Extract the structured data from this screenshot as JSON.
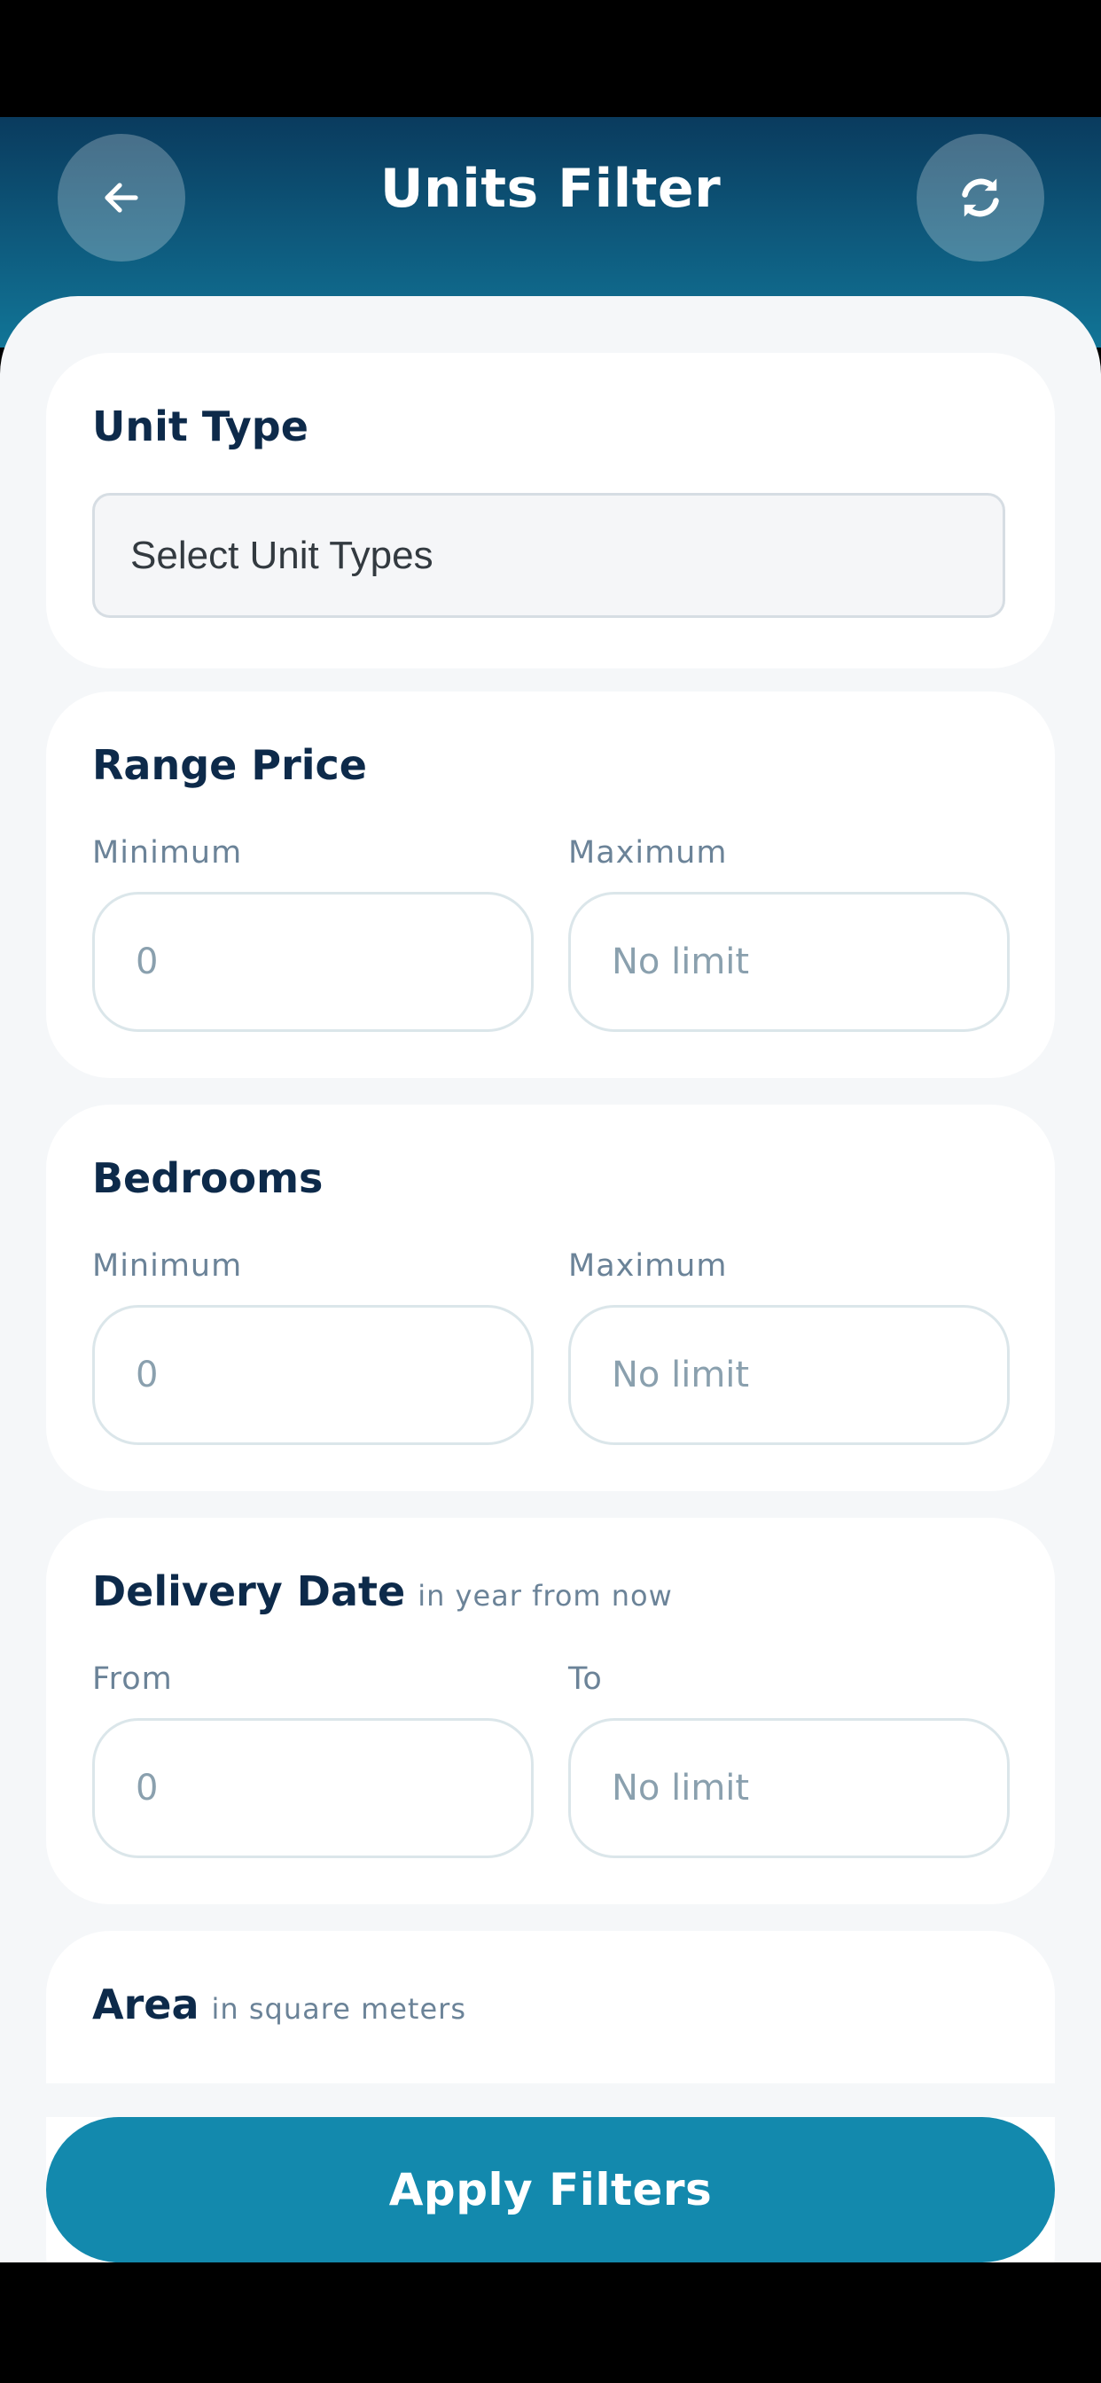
{
  "header": {
    "title": "Units Filter",
    "back_icon": "arrow-left-icon",
    "refresh_icon": "refresh-icon"
  },
  "unit_type": {
    "title": "Unit Type",
    "select_value": "Select Unit Types"
  },
  "range_price": {
    "title": "Range Price",
    "min_label": "Minimum",
    "min_placeholder": "0",
    "max_label": "Maximum",
    "max_placeholder": "No limit"
  },
  "bedrooms": {
    "title": "Bedrooms",
    "min_label": "Minimum",
    "min_placeholder": "0",
    "max_label": "Maximum",
    "max_placeholder": "No limit"
  },
  "delivery_date": {
    "title": "Delivery Date",
    "subtitle": "in year from now",
    "from_label": "From",
    "from_placeholder": "0",
    "to_label": "To",
    "to_placeholder": "No limit"
  },
  "area": {
    "title": "Area",
    "subtitle": "in square meters"
  },
  "apply_button": {
    "label": "Apply Filters"
  },
  "colors": {
    "header_top": "#0a3b5e",
    "header_bottom": "#117597",
    "accent": "#1389ad",
    "title_text": "#0d2a4a",
    "muted_text": "#6b8398"
  }
}
